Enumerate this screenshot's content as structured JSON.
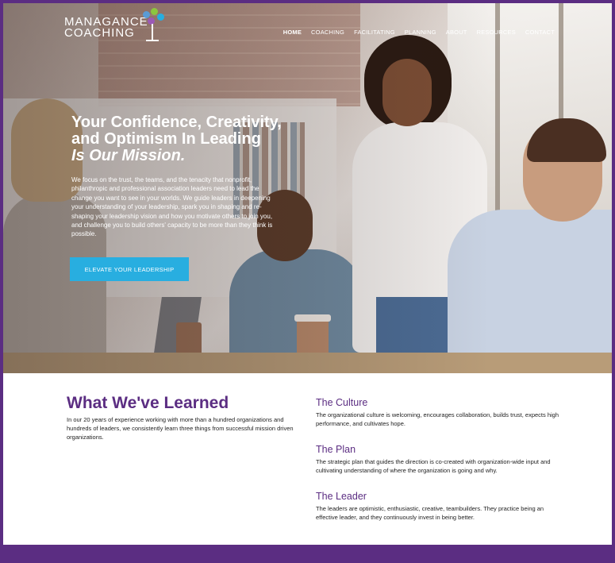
{
  "brand": {
    "line1": "MANAGANCE",
    "line2": "COACHING",
    "primary_color": "#5b2d82",
    "accent_color": "#28aee0"
  },
  "nav": {
    "items": [
      {
        "label": "HOME",
        "active": true
      },
      {
        "label": "COACHING",
        "active": false
      },
      {
        "label": "FACILITATING",
        "active": false
      },
      {
        "label": "PLANNING",
        "active": false
      },
      {
        "label": "ABOUT",
        "active": false
      },
      {
        "label": "RESOURCES",
        "active": false
      },
      {
        "label": "CONTACT",
        "active": false
      }
    ]
  },
  "hero": {
    "title_line1": "Your Confidence, Creativity,",
    "title_line2": "and Optimism In Leading",
    "title_emphasis": "Is Our Mission.",
    "body": "We focus on the trust, the teams, and the tenacity that nonprofit, philanthropic and professional association leaders need to lead the change you want to see in your worlds. We guide leaders in deepening your understanding of your leadership, spark you in shaping and re-shaping your leadership vision and how you motivate others to join you, and challenge you to build others' capacity to be more than they think is possible.",
    "cta_label": "ELEVATE YOUR LEADERSHIP"
  },
  "learned": {
    "title": "What We've Learned",
    "text": "In our 20 years of experience working with more than a hundred organizations and hundreds of leaders, we consistently learn three things from successful mission driven organizations.",
    "items": [
      {
        "title": "The Culture",
        "text": "The organizational culture is welcoming, encourages collaboration, builds trust, expects high performance, and cultivates hope."
      },
      {
        "title": "The Plan",
        "text": "The strategic plan that guides the direction is co-created with organization-wide input and cultivating understanding of where the organization is going and why."
      },
      {
        "title": "The Leader",
        "text": "The leaders are optimistic, enthusiastic, creative, teambuilders. They practice being an effective leader, and they continuously invest in being better."
      }
    ]
  }
}
